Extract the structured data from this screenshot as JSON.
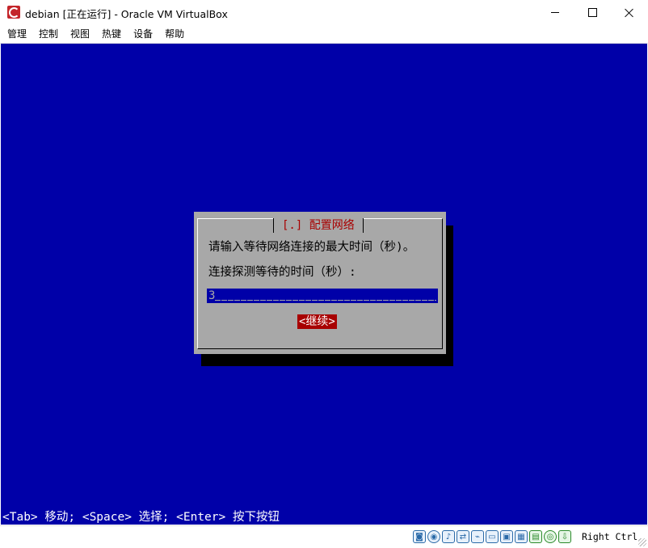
{
  "window": {
    "title": "debian [正在运行] - Oracle VM VirtualBox",
    "icon": "virtualbox-debian-icon"
  },
  "menubar": {
    "items": [
      "管理",
      "控制",
      "视图",
      "热键",
      "设备",
      "帮助"
    ]
  },
  "dialog": {
    "title": "[.] 配置网络",
    "line1": "请输入等待网络连接的最大时间（秒)。",
    "line2": "连接探测等待的时间（秒）:",
    "input_value": "3",
    "continue_label": "<继续>"
  },
  "hint": "<Tab> 移动; <Space> 选择; <Enter> 按下按钮",
  "statusbar": {
    "icons": [
      "hard-disk-icon",
      "optical-drive-icon",
      "audio-icon",
      "network-icon",
      "usb-icon",
      "shared-folder-icon",
      "display-icon",
      "video-capture-icon",
      "recording-icon",
      "guest-additions-icon",
      "mouse-integration-icon"
    ],
    "host_key": "Right Ctrl"
  },
  "colors": {
    "vm_background": "#0000a8",
    "dialog_background": "#a8a8a8",
    "accent_red": "#a80000"
  }
}
